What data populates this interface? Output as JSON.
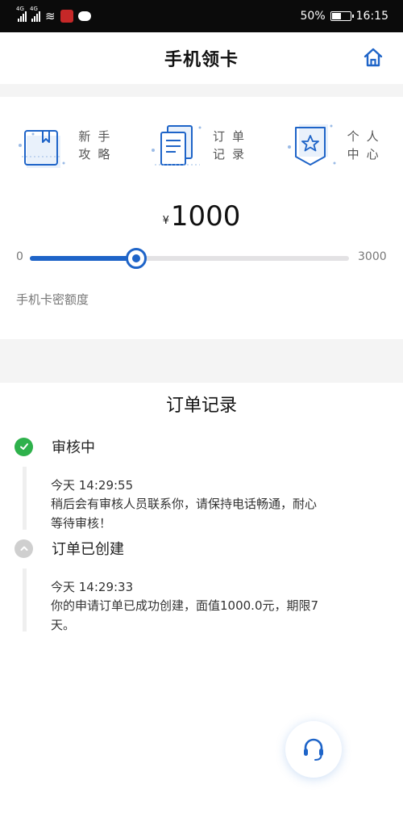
{
  "status_bar": {
    "battery": "50%",
    "time": "16:15",
    "network": "4G"
  },
  "header": {
    "title": "手机领卡"
  },
  "shortcuts": [
    {
      "label": "新手攻略",
      "icon": "book-icon"
    },
    {
      "label": "订单记录",
      "icon": "document-icon"
    },
    {
      "label": "个人中心",
      "icon": "star-badge-icon"
    }
  ],
  "amount": {
    "currency": "¥",
    "value": "1000"
  },
  "slider": {
    "min_label": "0",
    "max_label": "3000",
    "value": 1000,
    "min": 0,
    "max": 3000
  },
  "limit_label": "手机卡密额度",
  "orders": {
    "title": "订单记录",
    "items": [
      {
        "status": "审核中",
        "time": "今天 14:29:55",
        "message": "稍后会有审核人员联系你，请保持电话畅通，耐心等待审核！",
        "state": "done"
      },
      {
        "status": "订单已创建",
        "time": "今天 14:29:33",
        "message": "你的申请订单已成功创建，面值1000.0元，期限7天。",
        "state": "pending"
      }
    ]
  },
  "colors": {
    "accent": "#1e64c8",
    "success": "#2eb14b",
    "muted": "#cfcfcf"
  }
}
